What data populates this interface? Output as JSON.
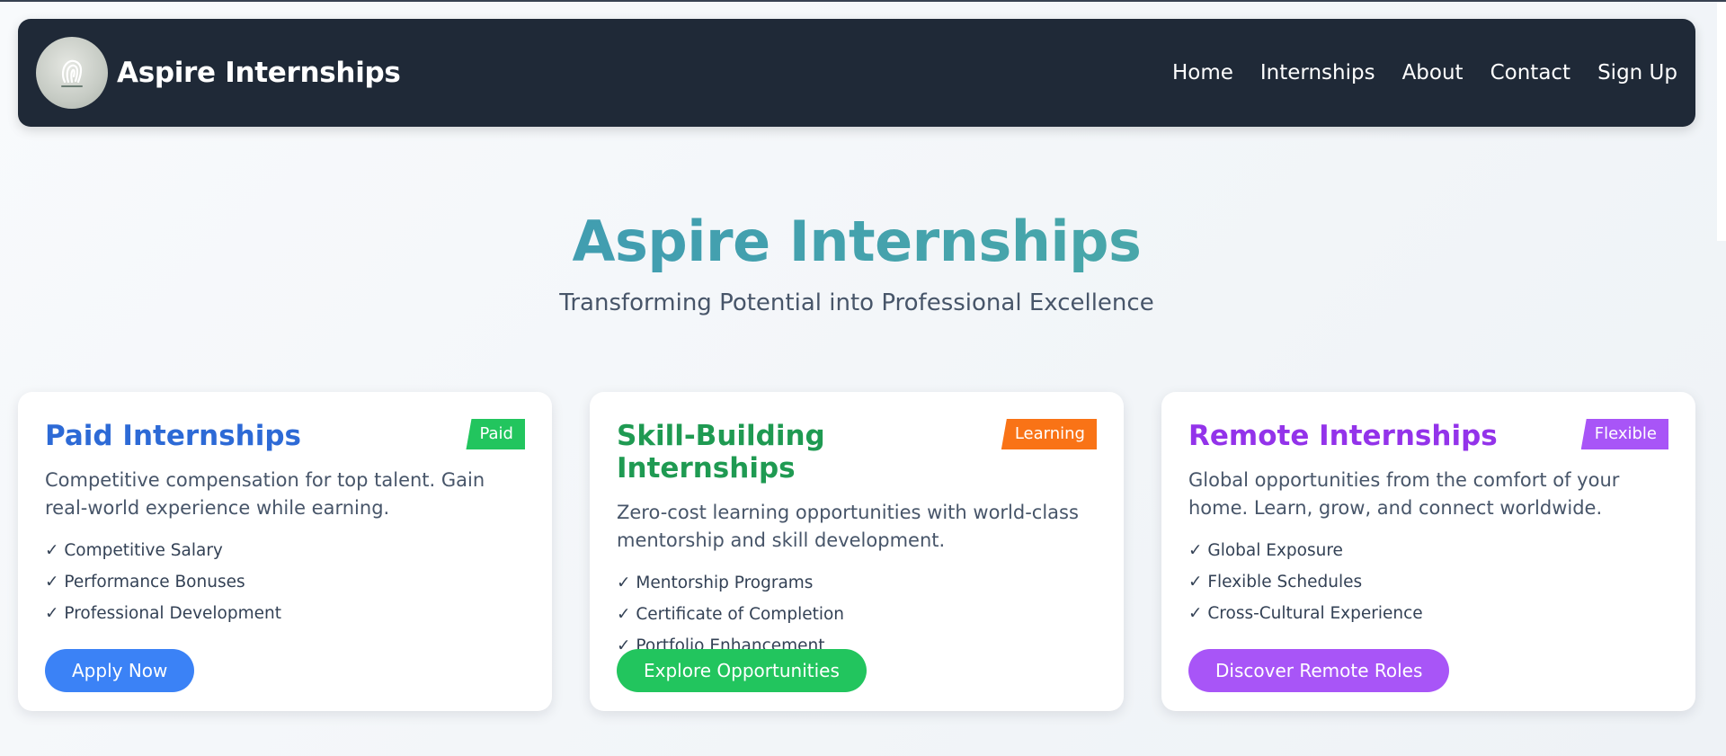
{
  "nav": {
    "brand": "Aspire Internships",
    "links": [
      "Home",
      "Internships",
      "About",
      "Contact",
      "Sign Up"
    ]
  },
  "hero": {
    "title": "Aspire Internships",
    "subtitle": "Transforming Potential into Professional Excellence"
  },
  "cards": [
    {
      "title": "Paid Internships",
      "badge": "Paid",
      "description": "Competitive compensation for top talent. Gain real-world experience while earning.",
      "features": [
        "✓ Competitive Salary",
        "✓ Performance Bonuses",
        "✓ Professional Development"
      ],
      "button": "Apply Now",
      "colors": {
        "title": "#2d6ad6",
        "badge": "#22c55e",
        "button": "#3b82f6"
      }
    },
    {
      "title": "Skill-Building Internships",
      "badge": "Learning",
      "description": "Zero-cost learning opportunities with world-class mentorship and skill development.",
      "features": [
        "✓ Mentorship Programs",
        "✓ Certificate of Completion",
        "✓ Portfolio Enhancement"
      ],
      "button": "Explore Opportunities",
      "colors": {
        "title": "#1f9a52",
        "badge": "#f97316",
        "button": "#22c55e"
      }
    },
    {
      "title": "Remote Internships",
      "badge": "Flexible",
      "description": "Global opportunities from the comfort of your home. Learn, grow, and connect worldwide.",
      "features": [
        "✓ Global Exposure",
        "✓ Flexible Schedules",
        "✓ Cross-Cultural Experience"
      ],
      "button": "Discover Remote Roles",
      "colors": {
        "title": "#9333ea",
        "badge": "#a855f7",
        "button": "#a855f7"
      }
    }
  ]
}
